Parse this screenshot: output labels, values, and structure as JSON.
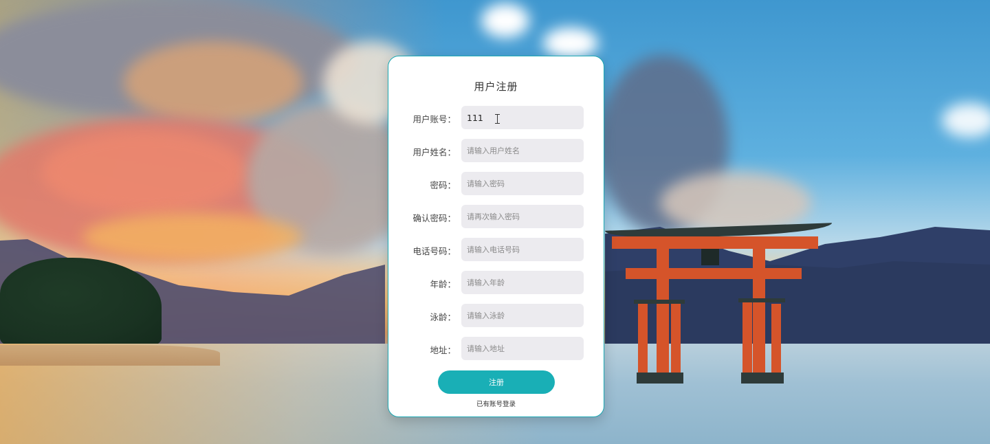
{
  "form": {
    "title": "用户注册",
    "fields": [
      {
        "label": "用户账号：",
        "value": "111",
        "placeholder": ""
      },
      {
        "label": "用户姓名：",
        "value": "",
        "placeholder": "请输入用户姓名"
      },
      {
        "label": "密码：",
        "value": "",
        "placeholder": "请输入密码"
      },
      {
        "label": "确认密码：",
        "value": "",
        "placeholder": "请再次输入密码"
      },
      {
        "label": "电话号码：",
        "value": "",
        "placeholder": "请输入电话号码"
      },
      {
        "label": "年龄：",
        "value": "",
        "placeholder": "请输入年龄"
      },
      {
        "label": "泳龄：",
        "value": "",
        "placeholder": "请输入泳龄"
      },
      {
        "label": "地址：",
        "value": "",
        "placeholder": "请输入地址"
      }
    ],
    "submit_label": "注册",
    "login_link": "已有账号登录"
  },
  "colors": {
    "accent": "#19afb6",
    "card_border": "#1aa8b3",
    "input_bg": "#ecebef"
  },
  "background": {
    "description_icon": "torii-gate-seascape-image"
  }
}
